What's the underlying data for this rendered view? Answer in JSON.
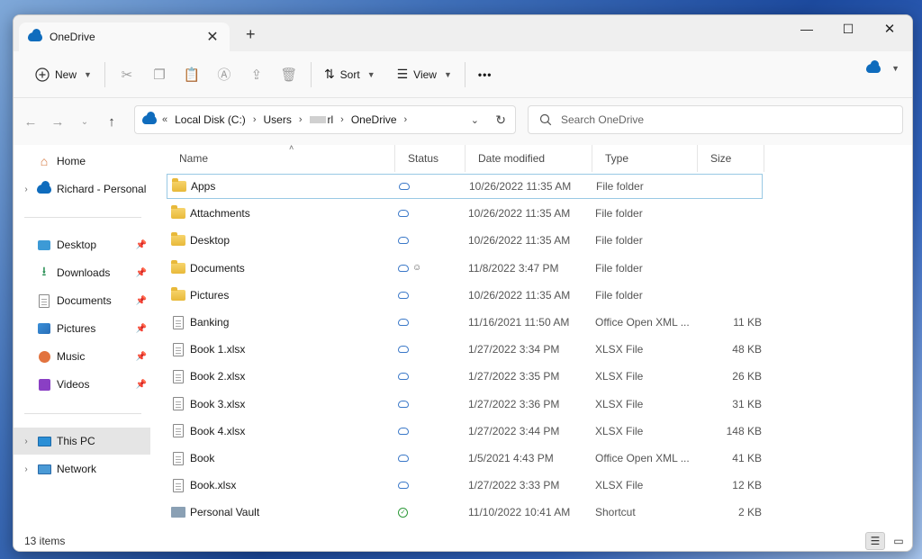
{
  "tab": {
    "title": "OneDrive",
    "close": "✕",
    "new": "+"
  },
  "window_controls": {
    "minimize": "—",
    "maximize": "☐",
    "close": "✕"
  },
  "toolbar": {
    "new_label": "New",
    "sort_label": "Sort",
    "view_label": "View",
    "more": "•••"
  },
  "address": {
    "crumbs": [
      "Local Disk (C:)",
      "Users",
      "rl",
      "OneDrive"
    ]
  },
  "search": {
    "placeholder": "Search OneDrive"
  },
  "sidebar": {
    "home": "Home",
    "onedrive": "Richard - Personal",
    "quick": [
      "Desktop",
      "Downloads",
      "Documents",
      "Pictures",
      "Music",
      "Videos"
    ],
    "this_pc": "This PC",
    "network": "Network"
  },
  "columns": {
    "name": "Name",
    "status": "Status",
    "date": "Date modified",
    "type": "Type",
    "size": "Size"
  },
  "files": [
    {
      "name": "Apps",
      "kind": "folder",
      "status": "cloud",
      "date": "10/26/2022 11:35 AM",
      "type": "File folder",
      "size": ""
    },
    {
      "name": "Attachments",
      "kind": "folder",
      "status": "cloud",
      "date": "10/26/2022 11:35 AM",
      "type": "File folder",
      "size": ""
    },
    {
      "name": "Desktop",
      "kind": "folder",
      "status": "cloud",
      "date": "10/26/2022 11:35 AM",
      "type": "File folder",
      "size": ""
    },
    {
      "name": "Documents",
      "kind": "folder",
      "status": "cloud-shared",
      "date": "11/8/2022 3:47 PM",
      "type": "File folder",
      "size": ""
    },
    {
      "name": "Pictures",
      "kind": "folder",
      "status": "cloud",
      "date": "10/26/2022 11:35 AM",
      "type": "File folder",
      "size": ""
    },
    {
      "name": "Banking",
      "kind": "doc",
      "status": "cloud",
      "date": "11/16/2021 11:50 AM",
      "type": "Office Open XML ...",
      "size": "11 KB"
    },
    {
      "name": "Book 1.xlsx",
      "kind": "doc",
      "status": "cloud",
      "date": "1/27/2022 3:34 PM",
      "type": "XLSX File",
      "size": "48 KB"
    },
    {
      "name": "Book 2.xlsx",
      "kind": "doc",
      "status": "cloud",
      "date": "1/27/2022 3:35 PM",
      "type": "XLSX File",
      "size": "26 KB"
    },
    {
      "name": "Book 3.xlsx",
      "kind": "doc",
      "status": "cloud",
      "date": "1/27/2022 3:36 PM",
      "type": "XLSX File",
      "size": "31 KB"
    },
    {
      "name": "Book 4.xlsx",
      "kind": "doc",
      "status": "cloud",
      "date": "1/27/2022 3:44 PM",
      "type": "XLSX File",
      "size": "148 KB"
    },
    {
      "name": "Book",
      "kind": "doc",
      "status": "cloud",
      "date": "1/5/2021 4:43 PM",
      "type": "Office Open XML ...",
      "size": "41 KB"
    },
    {
      "name": "Book.xlsx",
      "kind": "doc",
      "status": "cloud",
      "date": "1/27/2022 3:33 PM",
      "type": "XLSX File",
      "size": "12 KB"
    },
    {
      "name": "Personal Vault",
      "kind": "shortcut",
      "status": "ok",
      "date": "11/10/2022 10:41 AM",
      "type": "Shortcut",
      "size": "2 KB"
    }
  ],
  "statusbar": {
    "items": "13 items"
  }
}
